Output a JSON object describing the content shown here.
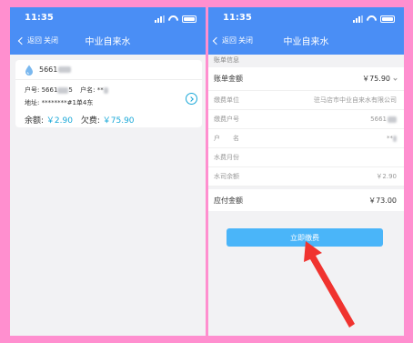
{
  "status_bar": {
    "time": "11:35"
  },
  "nav": {
    "back_label": "返回",
    "close_label": "关闭",
    "title": "中业自来水"
  },
  "account_card": {
    "account_id_prefix": "5661",
    "household_no_label": "户号:",
    "household_no_value": "5661",
    "household_no_suffix": "5",
    "name_label": "户名:",
    "name_value": "**",
    "address_label": "地址:",
    "address_value": "********#1单4东",
    "balance_label": "余额:",
    "balance_value": "￥2.90",
    "arrears_label": "欠费:",
    "arrears_value": "￥75.90"
  },
  "bill": {
    "section_title": "账单信息",
    "rows": [
      {
        "label": "账单金额",
        "value": "￥75.90"
      },
      {
        "label": "缴费单位",
        "value": "驻马店市中业自来水有限公司"
      },
      {
        "label": "缴费户号",
        "value": "5661"
      },
      {
        "label": "户　　名",
        "value": "**"
      },
      {
        "label": "水费月份",
        "value": ""
      },
      {
        "label": "水司余额",
        "value": "￥2.90"
      }
    ],
    "payable_label": "应付金额",
    "payable_value": "￥73.00",
    "pay_button_label": "立即缴费"
  },
  "colors": {
    "nav_blue": "#4a8ef5",
    "accent_cyan": "#1aa8d8",
    "button_blue": "#4ab5f9",
    "annotation_red": "#f0332f",
    "frame_pink": "#ff8fcf"
  },
  "icons": [
    "water-drop-icon",
    "chevron-right-icon",
    "back-chevron-icon",
    "signal-icon",
    "wifi-icon",
    "battery-icon",
    "annotation-arrow"
  ]
}
